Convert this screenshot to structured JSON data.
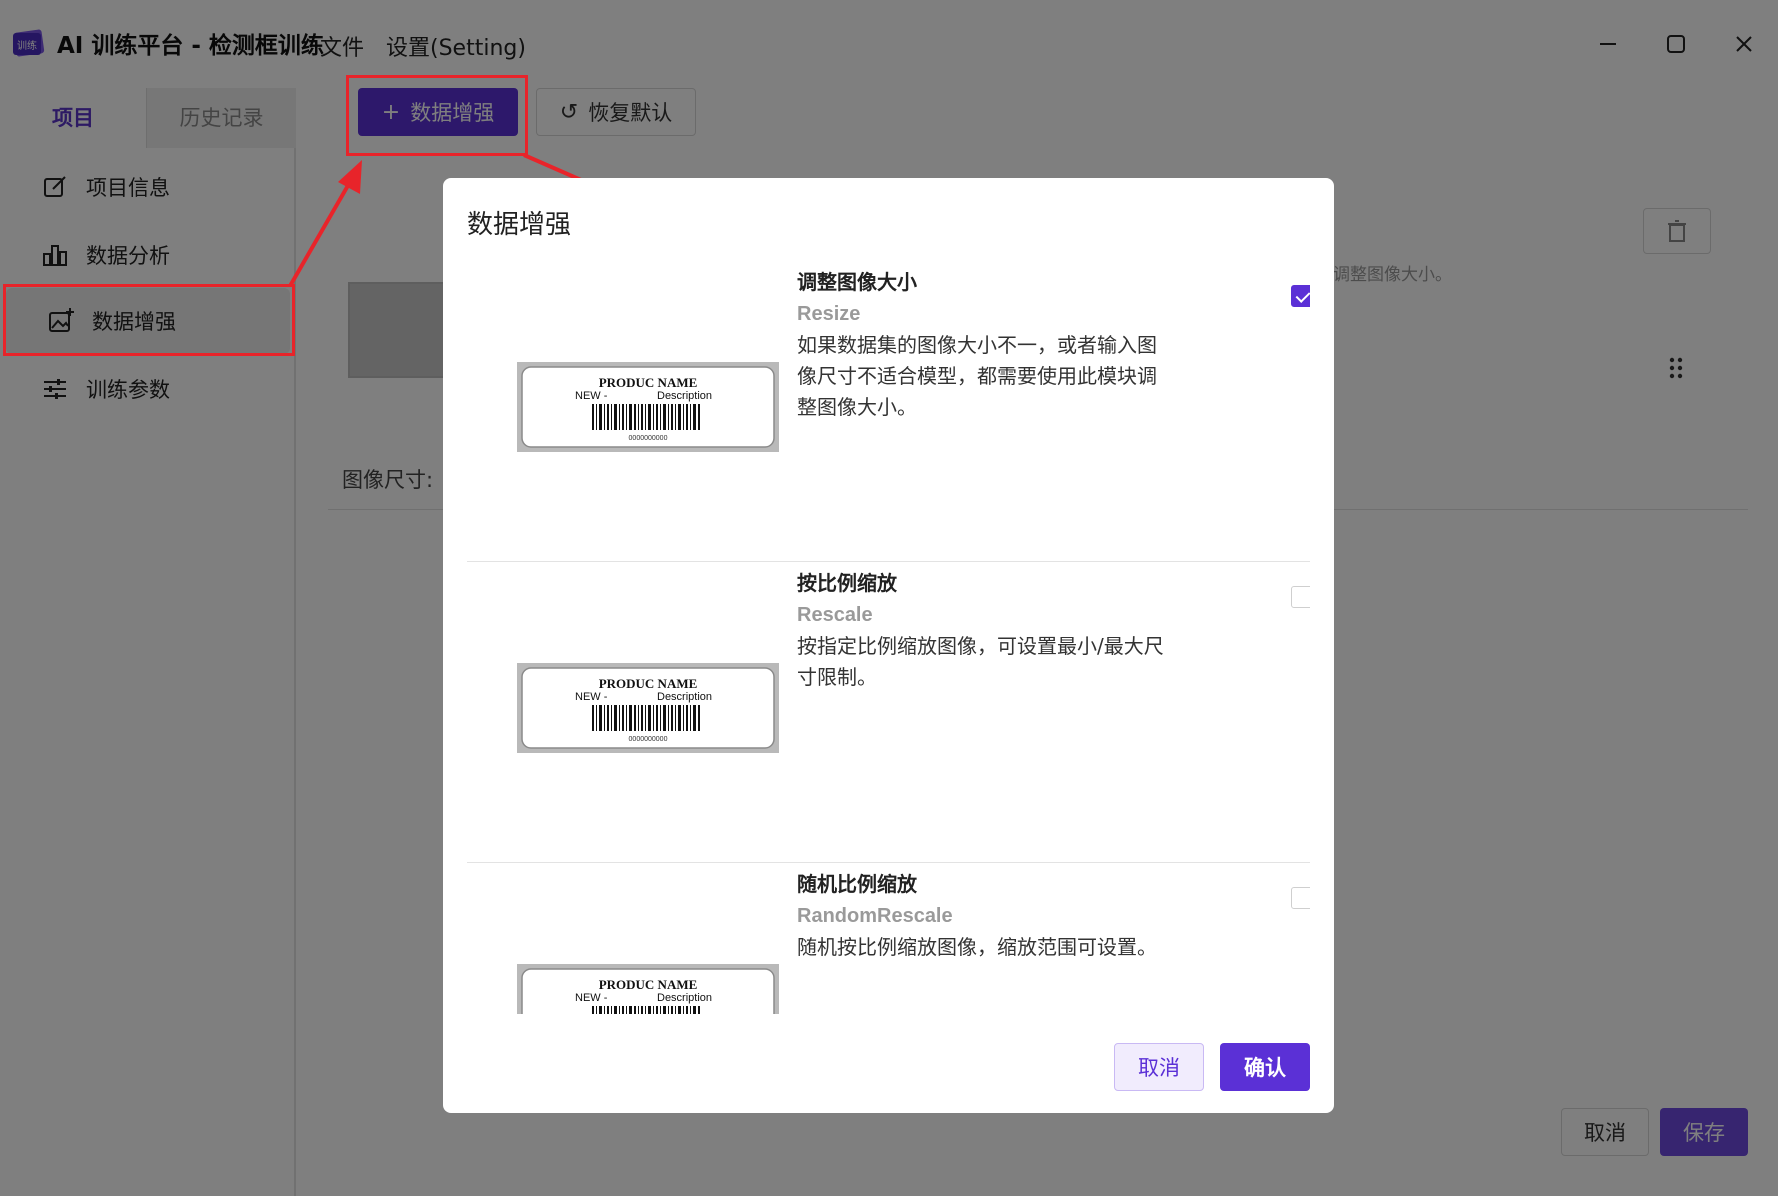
{
  "app": {
    "title": "AI 训练平台 - 检测框训练",
    "logo_text": "训练",
    "menu": {
      "file": "文件",
      "settings": "设置(Setting)"
    }
  },
  "sidebar": {
    "tabs": {
      "project": "项目",
      "history": "历史记录"
    },
    "items": [
      {
        "label": "项目信息",
        "icon": "edit-icon"
      },
      {
        "label": "数据分析",
        "icon": "bar-chart-icon"
      },
      {
        "label": "数据增强",
        "icon": "image-add-icon"
      },
      {
        "label": "训练参数",
        "icon": "sliders-icon"
      }
    ]
  },
  "main": {
    "toolbar": {
      "add_augmentation": "数据增强",
      "reset_default": "恢复默认"
    },
    "hint_text": "调整图像大小。",
    "image_size_label": "图像尺寸:",
    "cancel_label": "取消",
    "save_label": "保存"
  },
  "thumbnail": {
    "line1": "PRODUC   NAME",
    "line2_left": "NEW -",
    "line2_right": "Description",
    "barcode_number": "0000000000"
  },
  "modal": {
    "title": "数据增强",
    "items": [
      {
        "name": "调整图像大小",
        "en": "Resize",
        "desc": "如果数据集的图像大小不一，或者输入图像尺寸不适合模型，都需要使用此模块调整图像大小。",
        "checked": true
      },
      {
        "name": "按比例缩放",
        "en": "Rescale",
        "desc": "按指定比例缩放图像，可设置最小/最大尺寸限制。",
        "checked": false
      },
      {
        "name": "随机比例缩放",
        "en": "RandomRescale",
        "desc": "随机按比例缩放图像，缩放范围可设置。",
        "checked": false
      }
    ],
    "cancel_label": "取消",
    "confirm_label": "确认"
  },
  "colors": {
    "accent": "#5b30d6",
    "annotation": "#e8242a"
  }
}
